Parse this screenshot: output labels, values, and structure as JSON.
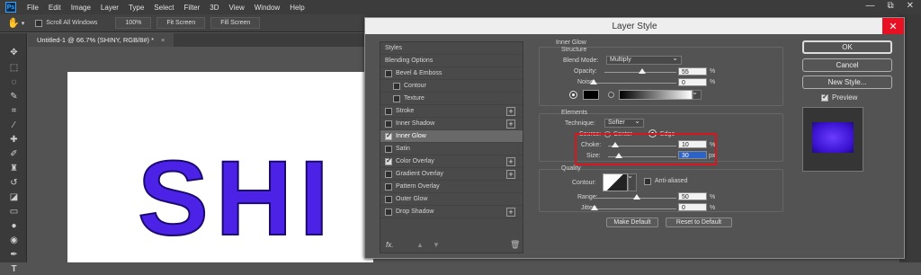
{
  "menubar": {
    "logo": "Ps",
    "items": [
      "File",
      "Edit",
      "Image",
      "Layer",
      "Type",
      "Select",
      "Filter",
      "3D",
      "View",
      "Window",
      "Help"
    ],
    "win_controls": [
      "—",
      "⧉",
      "✕"
    ]
  },
  "options": {
    "scroll_all": "Scroll All Windows",
    "zoom": "100%",
    "fit_screen": "Fit Screen",
    "fill_screen": "Fill Screen"
  },
  "document": {
    "tab": "Untitled-1 @ 66.7% (SHINY, RGB/8#) *",
    "tab_close": "×",
    "canvas_text": "SHI"
  },
  "dialog": {
    "title": "Layer Style",
    "close": "✕",
    "styles_header": "Styles",
    "blending": "Blending Options",
    "items": [
      {
        "label": "Bevel & Emboss",
        "checked": false,
        "plus": false
      },
      {
        "label": "Contour",
        "checked": false,
        "plus": false
      },
      {
        "label": "Texture",
        "checked": false,
        "plus": false
      },
      {
        "label": "Stroke",
        "checked": false,
        "plus": true
      },
      {
        "label": "Inner Shadow",
        "checked": false,
        "plus": true
      },
      {
        "label": "Inner Glow",
        "checked": true,
        "plus": false
      },
      {
        "label": "Satin",
        "checked": false,
        "plus": false
      },
      {
        "label": "Color Overlay",
        "checked": true,
        "plus": true
      },
      {
        "label": "Gradient Overlay",
        "checked": false,
        "plus": true
      },
      {
        "label": "Pattern Overlay",
        "checked": false,
        "plus": false
      },
      {
        "label": "Outer Glow",
        "checked": false,
        "plus": false
      },
      {
        "label": "Drop Shadow",
        "checked": false,
        "plus": true
      }
    ],
    "fx": "fx.",
    "inner_glow": {
      "title": "Inner Glow",
      "structure": "Structure",
      "blend_mode_label": "Blend Mode:",
      "blend_mode": "Multiply",
      "opacity_label": "Opacity:",
      "opacity": "55",
      "noise_label": "Noise:",
      "noise": "0",
      "pct": "%"
    },
    "elements": {
      "title": "Elements",
      "technique_label": "Technique:",
      "technique": "Softer",
      "source_label": "Source:",
      "center": "Center",
      "edge": "Edge",
      "choke_label": "Choke:",
      "choke": "10",
      "size_label": "Size:",
      "size": "30",
      "px": "px"
    },
    "quality": {
      "title": "Quality",
      "contour_label": "Contour:",
      "antialiased": "Anti-aliased",
      "range_label": "Range:",
      "range": "50",
      "jitter_label": "Jitter:",
      "jitter": "0"
    },
    "make_default": "Make Default",
    "reset_default": "Reset to Default",
    "ok": "OK",
    "cancel": "Cancel",
    "new_style": "New Style...",
    "preview": "Preview"
  },
  "colors": {
    "canvas_text": "#4b22e6",
    "dialog_bg": "#535353",
    "highlight": "#d8161b"
  }
}
